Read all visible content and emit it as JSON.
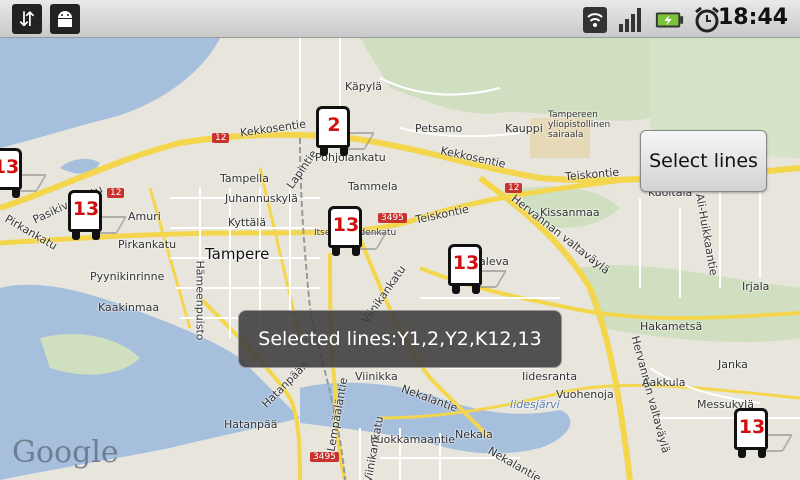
{
  "status_bar": {
    "time": "18:44",
    "icons": [
      "usb-icon",
      "android-debug-icon",
      "wifi-icon",
      "signal-icon",
      "battery-charging-icon",
      "alarm-clock-icon"
    ]
  },
  "map": {
    "attribution": "Google",
    "labels": {
      "kapyla": "Käpylä",
      "petsamo": "Petsamo",
      "kauppi": "Kauppi",
      "tays": "Tampereen yliopistollinen sairaala",
      "kekkosentie1": "Kekkosentie",
      "kekkosentie2": "Kekkosentie",
      "lapintie": "Lapintie",
      "pohjolankatu": "Pohjolankatu",
      "tampella": "Tampella",
      "tammela": "Tammela",
      "teiskontie1": "Teiskontie",
      "teiskontie2": "Teiskontie",
      "hervannan1": "Hervannan valtaväylä",
      "hervannan2": "Hervannan valtaväylä",
      "juhannuskyla": "Juhannuskylä",
      "kyttala": "Kyttälä",
      "amuri": "Amuri",
      "pasikivenkatu": "Pasikivenkatu",
      "pirkankatu1": "Pirkankatu",
      "pirkankatu2": "Pirkankatu",
      "tampere": "Tampere",
      "itsenaisyydenkatu": "Itsenäisyydenkatu",
      "viinikankatu1": "Viinikankatu",
      "viinikankatu2": "Viinikankatu",
      "kaleva": "Kaleva",
      "kissanmaa": "Kissanmaa",
      "kuoitala": "Kuoitala",
      "ali_huikkaantie": "Ali-Huikkaantie",
      "irjala": "Irjala",
      "pyynikinrinne": "Pyynikinrinne",
      "kaakinmaa": "Kaakinmaa",
      "hameenpuisto": "Hämeenpuisto",
      "hakametsa": "Hakametsä",
      "janka": "Janka",
      "iidesranta": "Iidesranta",
      "iidesjarvi": "Iidesjärvi",
      "vuohenoja": "Vuohenoja",
      "aakkula": "Aakkula",
      "messukyla": "Messukylä",
      "viinikka": "Viinikka",
      "hatanpaa": "Hatanpää",
      "hatanpaa_road": "Hatanpään",
      "lempaalantie": "Lempääläntie",
      "nekalantie1": "Nekalantie",
      "nekalantie2": "Nekalantie",
      "nekala": "Nekala",
      "kuokkamaantie": "Kuokkamaantie",
      "viinikankatu3": "Viinikankatu"
    },
    "road_shields": [
      "12",
      "12",
      "12",
      "3495",
      "3495"
    ]
  },
  "buses": [
    {
      "line": "2"
    },
    {
      "line": "13"
    },
    {
      "line": "13"
    },
    {
      "line": "13"
    },
    {
      "line": "13"
    },
    {
      "line": "13"
    }
  ],
  "select_lines_button": "Select lines",
  "toast": "Selected lines:Y1,2,Y2,K12,13"
}
